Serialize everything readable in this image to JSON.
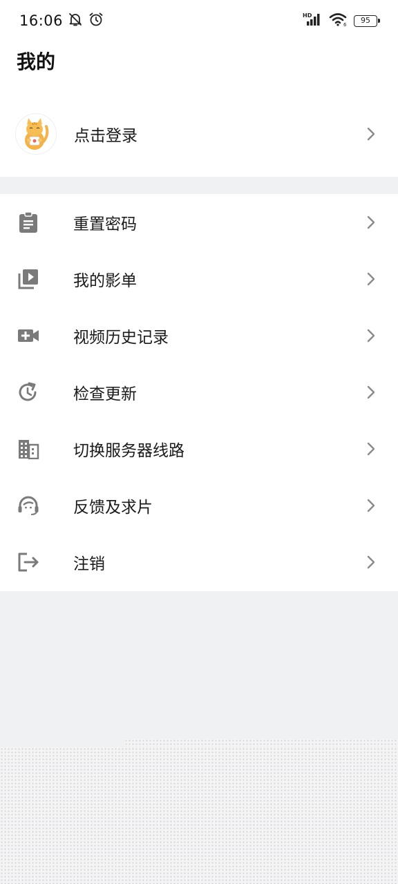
{
  "status_bar": {
    "time": "16:06",
    "network_label": "HD",
    "wifi_sub": "6",
    "battery": "95"
  },
  "header": {
    "title": "我的"
  },
  "profile": {
    "login_label": "点击登录",
    "avatar_icon": "cat-avatar-icon"
  },
  "menu": {
    "items": [
      {
        "label": "重置密码",
        "icon": "clipboard-icon"
      },
      {
        "label": "我的影单",
        "icon": "playlist-icon"
      },
      {
        "label": "视频历史记录",
        "icon": "video-add-icon"
      },
      {
        "label": "检查更新",
        "icon": "refresh-icon"
      },
      {
        "label": "切换服务器线路",
        "icon": "building-icon"
      },
      {
        "label": "反馈及求片",
        "icon": "support-agent-icon"
      },
      {
        "label": "注销",
        "icon": "logout-icon"
      }
    ]
  },
  "colors": {
    "icon_gray": "#7a7a7a",
    "chevron_gray": "#8a8a8a",
    "background": "#f0f1f3"
  }
}
